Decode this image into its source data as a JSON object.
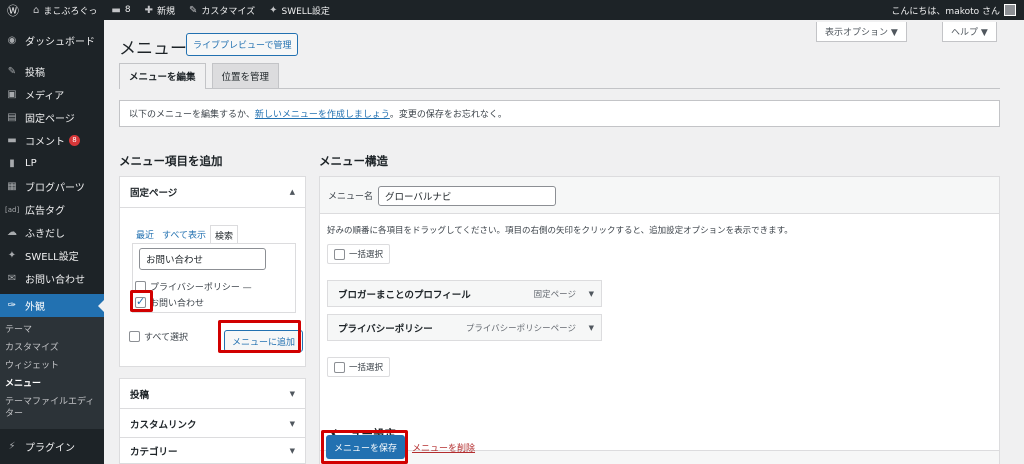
{
  "adminbar": {
    "site_name": "まこぶろぐっ",
    "comments_count": "8",
    "new_label": "新規",
    "customize_label": "カスタマイズ",
    "swell_label": "SWELL設定",
    "greeting": "こんにちは、makoto さん"
  },
  "sidebar": {
    "items": [
      {
        "label": "ダッシュボード",
        "icon": "dashboard-icon",
        "glyph": "◉"
      },
      {
        "label": "投稿",
        "icon": "pin-icon",
        "glyph": "✎"
      },
      {
        "label": "メディア",
        "icon": "media-icon",
        "glyph": "▣"
      },
      {
        "label": "固定ページ",
        "icon": "page-icon",
        "glyph": "▤"
      },
      {
        "label": "コメント",
        "icon": "comment-icon",
        "glyph": "▬",
        "badge": "8"
      },
      {
        "label": "LP",
        "icon": "lp-icon",
        "glyph": "▮"
      },
      {
        "label": "ブログパーツ",
        "icon": "blog-parts-icon",
        "glyph": "▦"
      },
      {
        "label": "広告タグ",
        "icon": "ad-tag-icon",
        "glyph": "[ad]"
      },
      {
        "label": "ふきだし",
        "icon": "balloon-icon",
        "glyph": "☁"
      },
      {
        "label": "SWELL設定",
        "icon": "swell-icon",
        "glyph": "✦"
      },
      {
        "label": "お問い合わせ",
        "icon": "mail-icon",
        "glyph": "✉"
      }
    ],
    "active": {
      "label": "外観",
      "icon": "appearance-icon",
      "glyph": "✑"
    },
    "submenu": [
      "テーマ",
      "カスタマイズ",
      "ウィジェット",
      "メニュー",
      "テーマファイルエディター"
    ],
    "plugins": {
      "label": "プラグイン",
      "icon": "plugin-icon",
      "glyph": "⚡"
    }
  },
  "header": {
    "title": "メニュー",
    "live_preview": "ライブプレビューで管理",
    "screen_options": "表示オプション ▼",
    "help": "ヘルプ ▼"
  },
  "tabs": [
    "メニューを編集",
    "位置を管理"
  ],
  "notice": {
    "before": "以下のメニューを編集するか、",
    "link": "新しいメニューを作成しましょう",
    "after": "。変更の保存をお忘れなく。"
  },
  "add_items": {
    "title": "メニュー項目を追加",
    "pages_section": "固定ページ",
    "inner_tabs": [
      "最近",
      "すべて表示",
      "検索"
    ],
    "search_value": "お問い合わせ",
    "results": [
      "プライバシーポリシー —",
      "お問い合わせ"
    ],
    "select_all": "すべて選択",
    "add_button": "メニューに追加",
    "other_sections": [
      "投稿",
      "カスタムリンク",
      "カテゴリー"
    ]
  },
  "structure": {
    "title": "メニュー構造",
    "menu_name_label": "メニュー名",
    "menu_name_value": "グローバルナビ",
    "instructions": "好みの順番に各項目をドラッグしてください。項目の右側の矢印をクリックすると、追加設定オプションを表示できます。",
    "bulk_select": "一括選択",
    "items": [
      {
        "title": "ブロガーまことのプロフィール",
        "type": "固定ページ"
      },
      {
        "title": "プライバシーポリシー",
        "type": "プライバシーポリシーページ"
      }
    ],
    "settings_title": "メニュー設定",
    "save_button": "メニューを保存",
    "delete_link": "メニューを削除"
  },
  "colors": {
    "accent": "#2271b1",
    "highlight": "#d10000",
    "adminbar": "#1d2327"
  }
}
